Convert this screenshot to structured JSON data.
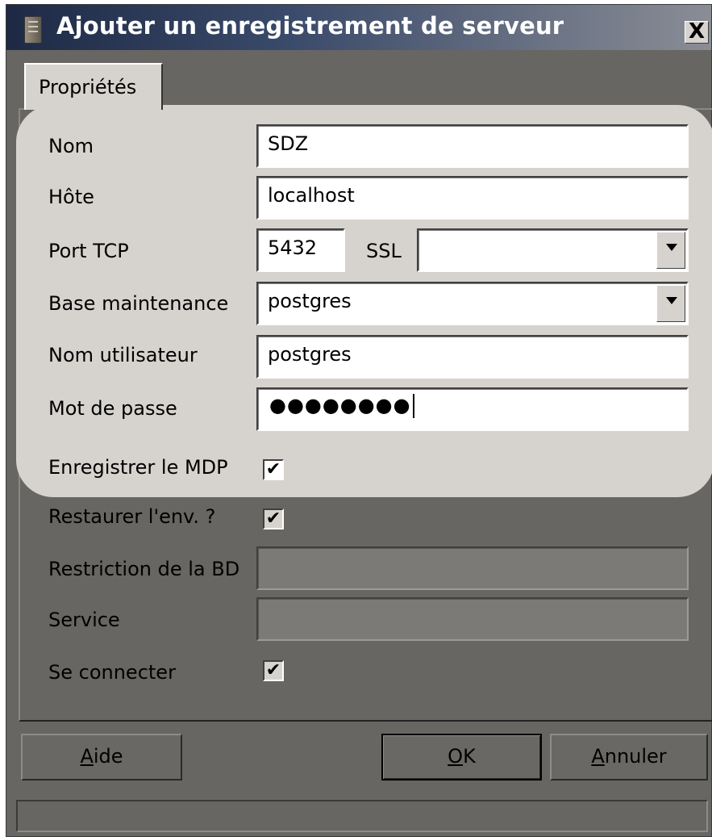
{
  "window": {
    "title": "Ajouter un enregistrement de serveur",
    "close_label": "X"
  },
  "tabs": [
    {
      "label": "Propriétés"
    }
  ],
  "form": {
    "name_label": "Nom",
    "name_value": "SDZ",
    "host_label": "Hôte",
    "host_value": "localhost",
    "port_label": "Port TCP",
    "port_value": "5432",
    "ssl_label": "SSL",
    "ssl_value": "",
    "maintenance_db_label": "Base maintenance",
    "maintenance_db_value": "postgres",
    "username_label": "Nom utilisateur",
    "username_value": "postgres",
    "password_label": "Mot de passe",
    "password_value": "●●●●●●●●",
    "save_password_label": "Enregistrer le MDP",
    "save_password_checked": true,
    "restore_env_label": "Restaurer l'env. ?",
    "restore_env_checked": true,
    "db_restriction_label": "Restriction de la BD",
    "db_restriction_value": "",
    "service_label": "Service",
    "service_value": "",
    "connect_label": "Se connecter",
    "connect_checked": true,
    "checkmark": "✔"
  },
  "buttons": {
    "help_mnemonic": "A",
    "help_rest": "ide",
    "ok_mnemonic": "O",
    "ok_rest": "K",
    "cancel_mnemonic": "A",
    "cancel_rest": "nnuler"
  }
}
